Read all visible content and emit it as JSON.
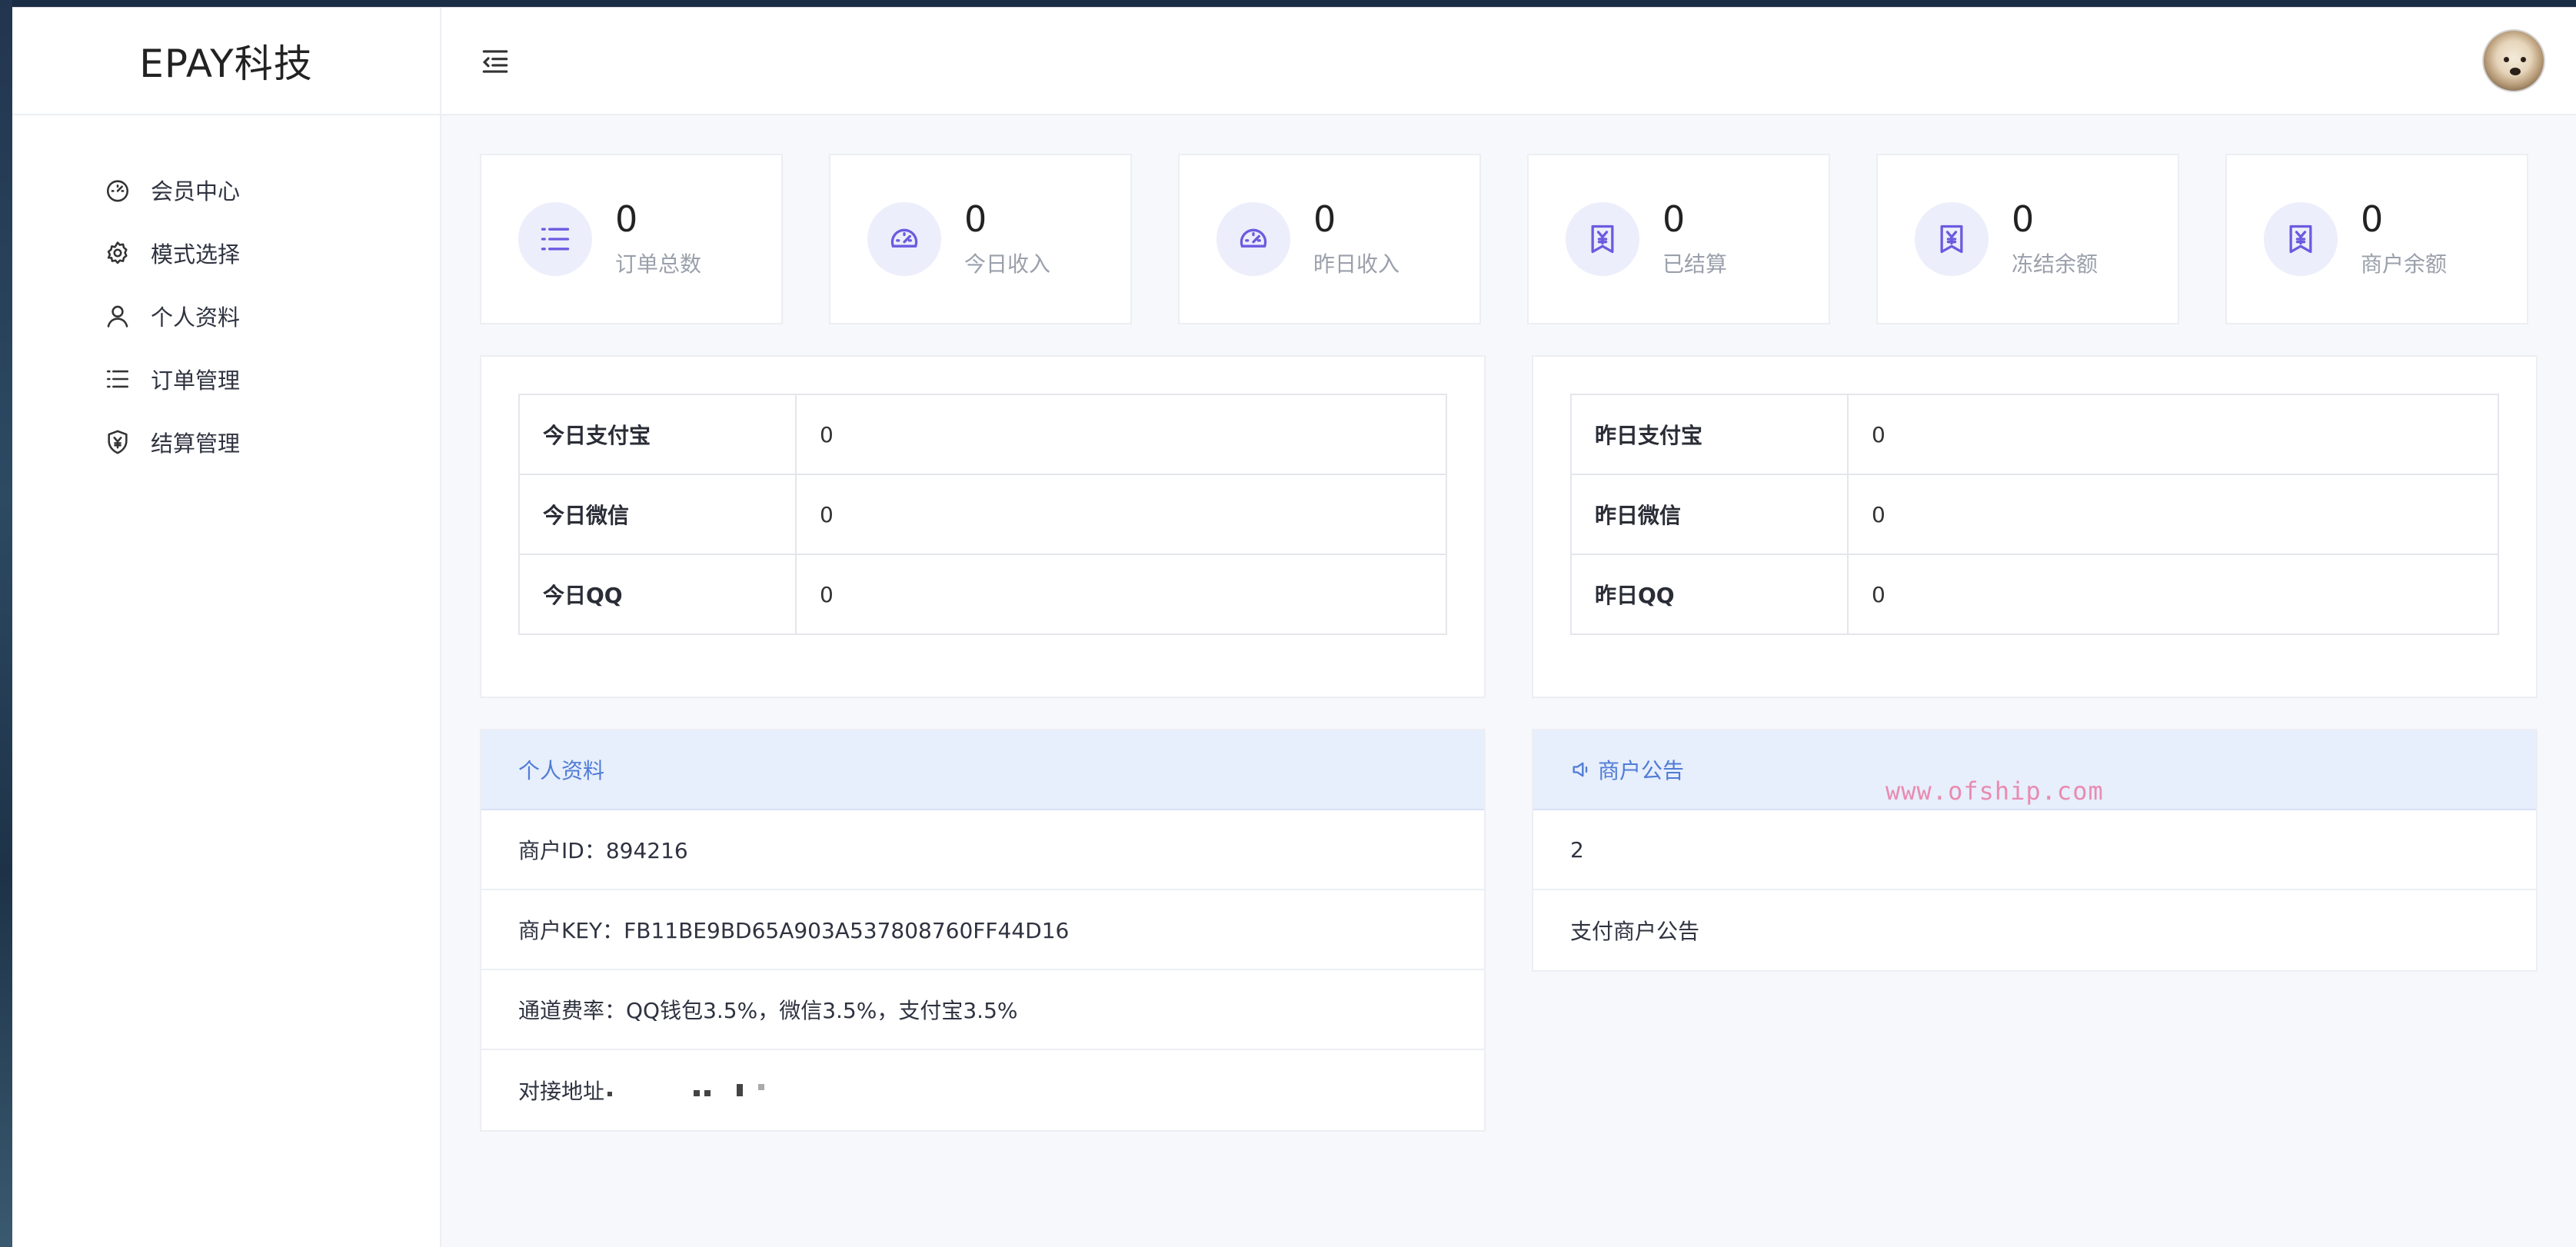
{
  "brand": "EPAY科技",
  "sidebar": {
    "items": [
      {
        "label": "会员中心",
        "icon": "dashboard-icon"
      },
      {
        "label": "模式选择",
        "icon": "gear-icon"
      },
      {
        "label": "个人资料",
        "icon": "user-icon"
      },
      {
        "label": "订单管理",
        "icon": "list-icon"
      },
      {
        "label": "结算管理",
        "icon": "yen-shield-icon"
      }
    ]
  },
  "stats": [
    {
      "value": "0",
      "label": "订单总数",
      "icon": "list-icon"
    },
    {
      "value": "0",
      "label": "今日收入",
      "icon": "gauge-icon"
    },
    {
      "value": "0",
      "label": "昨日收入",
      "icon": "gauge-icon"
    },
    {
      "value": "0",
      "label": "已结算",
      "icon": "yen-bookmark-icon"
    },
    {
      "value": "0",
      "label": "冻结余额",
      "icon": "yen-bookmark-icon"
    },
    {
      "value": "0",
      "label": "商户余额",
      "icon": "yen-bookmark-icon"
    }
  ],
  "today": [
    {
      "key": "今日支付宝",
      "value": "0"
    },
    {
      "key": "今日微信",
      "value": "0"
    },
    {
      "key": "今日QQ",
      "value": "0"
    }
  ],
  "yesterday": [
    {
      "key": "昨日支付宝",
      "value": "0"
    },
    {
      "key": "昨日微信",
      "value": "0"
    },
    {
      "key": "昨日QQ",
      "value": "0"
    }
  ],
  "profile": {
    "title": "个人资料",
    "merchant_id": "商户ID：894216",
    "merchant_key": "商户KEY：FB11BE9BD65A903A537808760FF44D16",
    "rates": "通道费率：QQ钱包3.5%，微信3.5%，支付宝3.5%",
    "address_label": "对接地址"
  },
  "notice": {
    "title": "商户公告",
    "rows": [
      "2",
      "支付商户公告"
    ]
  },
  "watermark": "www.ofship.com",
  "colors": {
    "accent": "#4f7cd6",
    "icon": "#6a5be0",
    "icon_bg": "#eceefb"
  }
}
